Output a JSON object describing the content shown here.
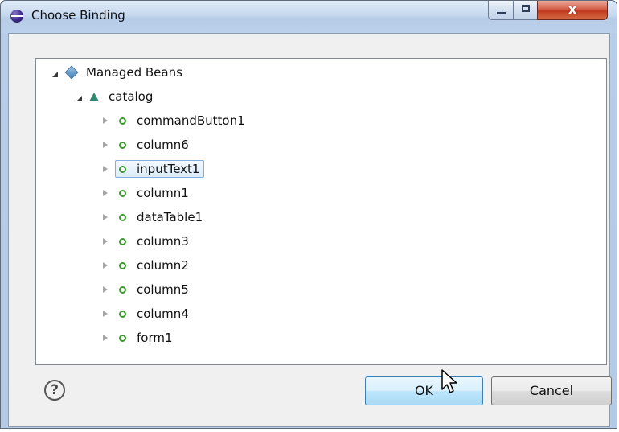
{
  "window": {
    "title": "Choose Binding",
    "controls": {
      "minimize": "minimize-icon",
      "maximize": "maximize-icon",
      "close": "close-icon"
    }
  },
  "tree": {
    "root": {
      "label": "Managed Beans",
      "expanded": true,
      "icon": "managed-beans-icon"
    },
    "bean": {
      "label": "catalog",
      "expanded": true,
      "icon": "bean-icon"
    },
    "items": [
      {
        "label": "commandButton1",
        "selected": false
      },
      {
        "label": "column6",
        "selected": false
      },
      {
        "label": "inputText1",
        "selected": true
      },
      {
        "label": "column1",
        "selected": false
      },
      {
        "label": "dataTable1",
        "selected": false
      },
      {
        "label": "column3",
        "selected": false
      },
      {
        "label": "column2",
        "selected": false
      },
      {
        "label": "column5",
        "selected": false
      },
      {
        "label": "column4",
        "selected": false
      },
      {
        "label": "form1",
        "selected": false
      }
    ]
  },
  "footer": {
    "help_glyph": "?",
    "ok_label": "OK",
    "cancel_label": "Cancel"
  },
  "colors": {
    "selection_border": "#84acdd",
    "property_icon": "#3c9a2e",
    "bean_icon": "#2f8a74"
  }
}
